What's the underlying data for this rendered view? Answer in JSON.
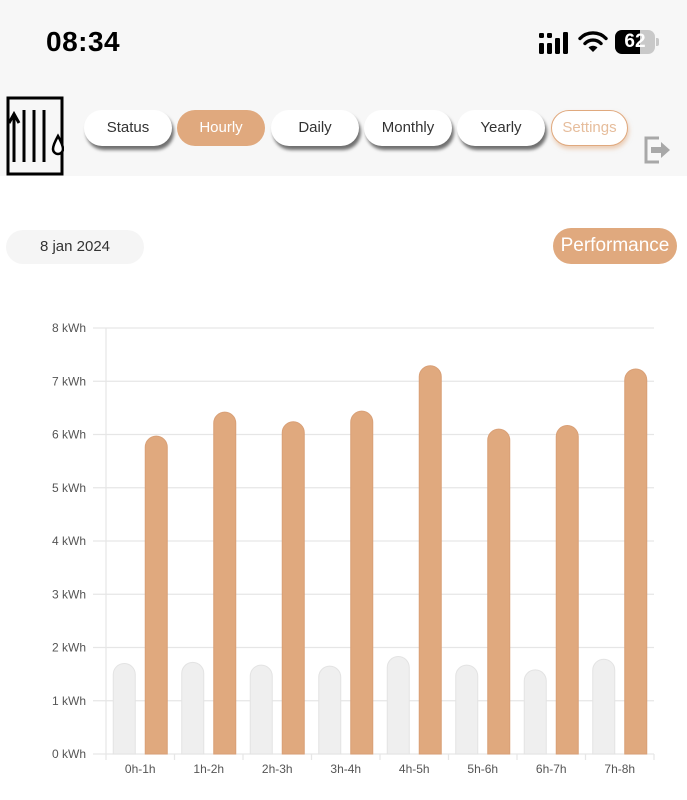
{
  "status_bar": {
    "time": "08:34",
    "battery": "62",
    "battery_level": 0.62,
    "icons": [
      "signal-icon",
      "wifi-icon",
      "battery-icon"
    ]
  },
  "nav": {
    "logo_icon": "radiator-logo-icon",
    "tabs": [
      {
        "label": "Status",
        "state": "default"
      },
      {
        "label": "Hourly",
        "state": "active"
      },
      {
        "label": "Daily",
        "state": "default"
      },
      {
        "label": "Monthly",
        "state": "default"
      },
      {
        "label": "Yearly",
        "state": "default"
      },
      {
        "label": "Settings",
        "state": "outline"
      }
    ],
    "logout_icon": "logout-icon"
  },
  "controls": {
    "date": "8 jan 2024",
    "performance_label": "Performance"
  },
  "colors": {
    "accent": "#e0a97e",
    "secondary_bar": "#efefef",
    "grid": "#e6e6e6",
    "background": "#f7f7f7"
  },
  "chart_data": {
    "type": "bar",
    "categories": [
      "0h-1h",
      "1h-2h",
      "2h-3h",
      "3h-4h",
      "4h-5h",
      "5h-6h",
      "6h-7h",
      "7h-8h"
    ],
    "series": [
      {
        "values": [
          1.7,
          1.72,
          1.67,
          1.65,
          1.83,
          1.67,
          1.58,
          1.78
        ],
        "color": "#efefef"
      },
      {
        "values": [
          5.97,
          6.42,
          6.24,
          6.44,
          7.29,
          6.1,
          6.17,
          7.23
        ],
        "color": "#e0a97e"
      }
    ],
    "y_ticks": [
      "0 kWh",
      "1 kWh",
      "2 kWh",
      "3 kWh",
      "4 kWh",
      "5 kWh",
      "6 kWh",
      "7 kWh",
      "8 kWh"
    ],
    "ylim": [
      0,
      8
    ],
    "grid": true,
    "legend": "none"
  }
}
